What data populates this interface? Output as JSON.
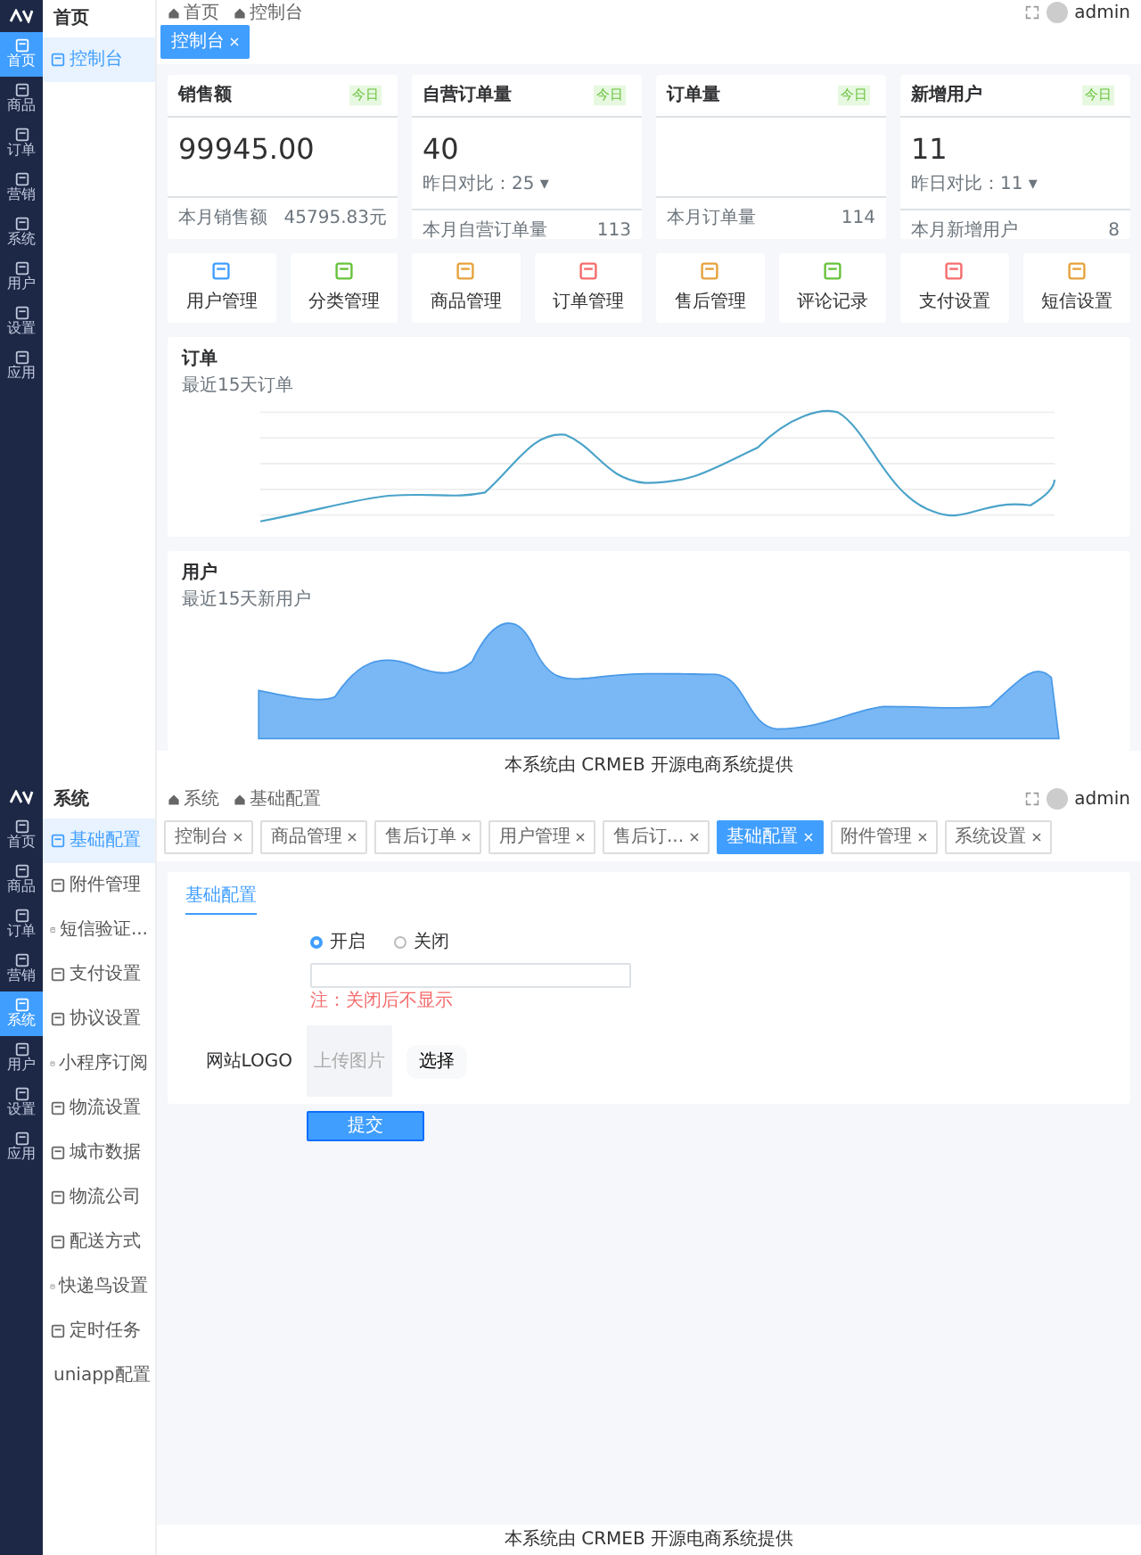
{
  "dashboard": {
    "rail": [
      {
        "label": "首页",
        "selected": true
      },
      {
        "label": "商品",
        "selected": false
      },
      {
        "label": "订单",
        "selected": false
      },
      {
        "label": "营销",
        "selected": false
      },
      {
        "label": "系统",
        "selected": false
      },
      {
        "label": "用户",
        "selected": false
      },
      {
        "label": "设置",
        "selected": false
      },
      {
        "label": "应用",
        "selected": false
      }
    ],
    "sidebar": {
      "title": "首页",
      "items": [
        {
          "label": "控制台",
          "selected": true
        }
      ]
    },
    "breadcrumb": [
      "首页",
      "控制台"
    ],
    "tags": [
      {
        "label": "控制台",
        "selected": true
      }
    ],
    "user": "admin",
    "stat_cards": [
      {
        "title": "销售额",
        "badge": "今日",
        "value": "99945.00",
        "footer_label": "本月销售额",
        "footer_value": "45795.83元"
      },
      {
        "title": "自营订单量",
        "badge": "今日",
        "value": "40",
        "compare": "昨日对比：25 ▾",
        "footer_label": "本月自营订单量",
        "footer_value": "113"
      },
      {
        "title": "订单量",
        "badge": "今日",
        "footer_label": "本月订单量",
        "footer_value": "114"
      },
      {
        "title": "新增用户",
        "badge": "今日",
        "value": "11",
        "compare": "昨日对比：11 ▾",
        "footer_label": "本月新增用户",
        "footer_value": "8"
      }
    ],
    "shortcuts": [
      {
        "label": "用户管理",
        "color": "#409eff"
      },
      {
        "label": "分类管理",
        "color": "#67c23a"
      },
      {
        "label": "商品管理",
        "color": "#e6a23c"
      },
      {
        "label": "订单管理",
        "color": "#f56c6c"
      },
      {
        "label": "售后管理",
        "color": "#e6a23c"
      },
      {
        "label": "评论记录",
        "color": "#67c23a"
      },
      {
        "label": "支付设置",
        "color": "#f56c6c"
      },
      {
        "label": "短信设置",
        "color": "#e6a23c"
      }
    ],
    "charts": [
      {
        "kind": "line",
        "title": "订单",
        "subtitle": "最近15天订单"
      },
      {
        "kind": "area",
        "title": "用户",
        "subtitle": "最近15天新用户"
      }
    ],
    "footer": "本系统由 CRMEB 开源电商系统提供"
  },
  "settings": {
    "rail": [
      {
        "label": "首页",
        "selected": false
      },
      {
        "label": "商品",
        "selected": false
      },
      {
        "label": "订单",
        "selected": false
      },
      {
        "label": "营销",
        "selected": false
      },
      {
        "label": "系统",
        "selected": true
      },
      {
        "label": "用户",
        "selected": false
      },
      {
        "label": "设置",
        "selected": false
      },
      {
        "label": "应用",
        "selected": false
      }
    ],
    "sidebar": {
      "title": "系统",
      "items": [
        {
          "label": "基础配置",
          "selected": true
        },
        {
          "label": "附件管理",
          "selected": false
        },
        {
          "label": "短信验证...",
          "selected": false
        },
        {
          "label": "支付设置",
          "selected": false
        },
        {
          "label": "协议设置",
          "selected": false
        },
        {
          "label": "小程序订阅",
          "selected": false
        },
        {
          "label": "物流设置",
          "selected": false
        },
        {
          "label": "城市数据",
          "selected": false
        },
        {
          "label": "物流公司",
          "selected": false
        },
        {
          "label": "配送方式",
          "selected": false
        },
        {
          "label": "快递鸟设置",
          "selected": false
        },
        {
          "label": "定时任务",
          "selected": false
        },
        {
          "label": "uniapp配置",
          "selected": false
        }
      ]
    },
    "breadcrumb": [
      "系统",
      "基础配置"
    ],
    "user": "admin",
    "tabs": [
      {
        "label": "控制台",
        "selected": false
      },
      {
        "label": "商品管理",
        "selected": false
      },
      {
        "label": "售后订单",
        "selected": false
      },
      {
        "label": "用户管理",
        "selected": false
      },
      {
        "label": "售后订...",
        "selected": false
      },
      {
        "label": "基础配置",
        "selected": true
      },
      {
        "label": "附件管理",
        "selected": false
      },
      {
        "label": "系统设置",
        "selected": false
      }
    ],
    "form_tab": "基础配置",
    "radios": [
      {
        "label": "开启",
        "selected": true
      },
      {
        "label": "关闭",
        "selected": false
      }
    ],
    "hint": "注：关闭后不显示",
    "upload_label": "网站LOGO",
    "upload_placeholder": "上传图片",
    "choose_button": "选择",
    "submit_button": "提交",
    "footer": "本系统由 CRMEB 开源电商系统提供"
  }
}
